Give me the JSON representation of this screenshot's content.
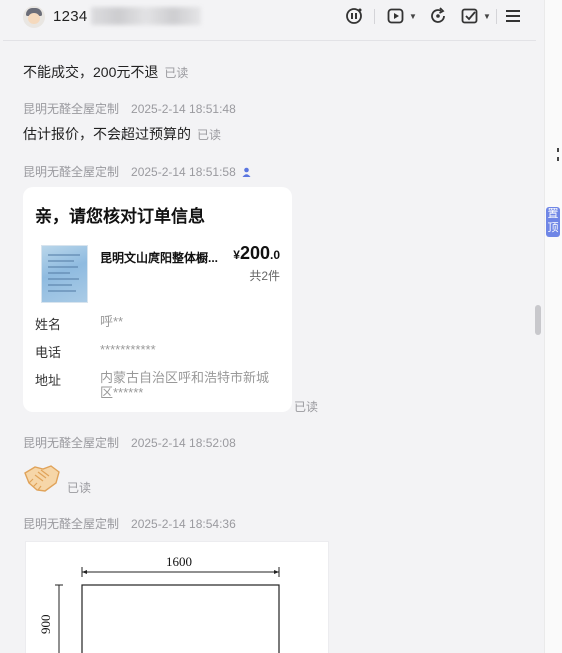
{
  "header": {
    "title": "1234",
    "icons": [
      "ai-assist-icon",
      "video-play-icon",
      "refresh-icon",
      "checklist-icon",
      "menu-icon"
    ]
  },
  "messages": [
    {
      "text": "不能成交，200元不退",
      "read": "已读"
    },
    {
      "sender": "昆明无醛全屋定制",
      "time": "2025-2-14 18:51:48",
      "text": "估计报价，不会超过预算的",
      "read": "已读"
    },
    {
      "sender": "昆明无醛全屋定制",
      "time": "2025-2-14 18:51:58"
    },
    {
      "sender": "昆明无醛全屋定制",
      "time": "2025-2-14 18:52:08",
      "read": "已读"
    },
    {
      "sender": "昆明无醛全屋定制",
      "time": "2025-2-14 18:54:36"
    }
  ],
  "order": {
    "title": "亲，请您核对订单信息",
    "product_name": "昆明文山庹阳整体橱...",
    "price_currency": "¥",
    "price_int": "200",
    "price_dec": ".0",
    "count": "共2件",
    "name_label": "姓名",
    "name_value": "呼**",
    "phone_label": "电话",
    "phone_value": "***********",
    "addr_label": "地址",
    "addr_value": "内蒙古自治区呼和浩特市新城区******",
    "read": "已读"
  },
  "drawing": {
    "width_label": "1600",
    "height_label": "900"
  },
  "side": {
    "pin_label": "置顶"
  },
  "colors": {
    "background": "#f3f3f5",
    "card": "#ffffff",
    "meta_gray": "#9a9a9f",
    "pin_blue": "#6f86e6"
  }
}
